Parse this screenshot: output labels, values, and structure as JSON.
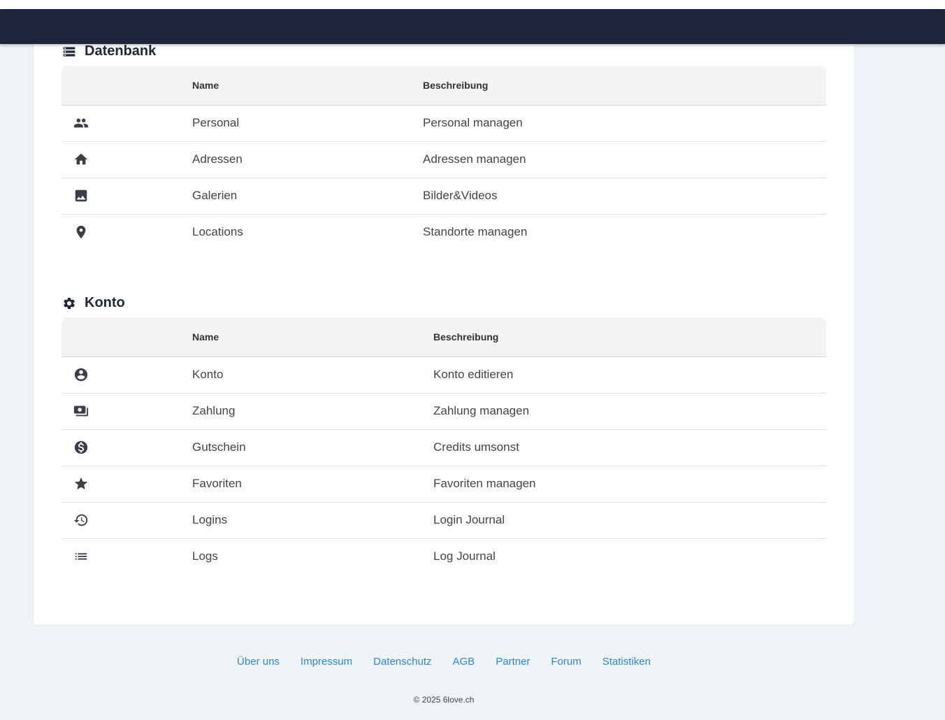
{
  "datenbank": {
    "title": "Datenbank",
    "icon": "database-list-icon",
    "headers": {
      "name": "Name",
      "description": "Beschreibung"
    },
    "rows": [
      {
        "icon": "people-icon",
        "name": "Personal",
        "description": "Personal managen"
      },
      {
        "icon": "home-icon",
        "name": "Adressen",
        "description": "Adressen managen"
      },
      {
        "icon": "image-icon",
        "name": "Galerien",
        "description": "Bilder&Videos"
      },
      {
        "icon": "location-pin-icon",
        "name": "Locations",
        "description": "Standorte managen"
      }
    ]
  },
  "konto": {
    "title": "Konto",
    "icon": "gear-icon",
    "headers": {
      "name": "Name",
      "description": "Beschreibung"
    },
    "rows": [
      {
        "icon": "account-circle-icon",
        "name": "Konto",
        "description": "Konto editieren"
      },
      {
        "icon": "payments-icon",
        "name": "Zahlung",
        "description": "Zahlung managen"
      },
      {
        "icon": "dollar-coin-icon",
        "name": "Gutschein",
        "description": "Credits umsonst"
      },
      {
        "icon": "star-icon",
        "name": "Favoriten",
        "description": "Favoriten managen"
      },
      {
        "icon": "history-icon",
        "name": "Logins",
        "description": "Login Journal"
      },
      {
        "icon": "list-icon",
        "name": "Logs",
        "description": "Log Journal"
      }
    ]
  },
  "footer": {
    "links": [
      "Über uns",
      "Impressum",
      "Datenschutz",
      "AGB",
      "Partner",
      "Forum",
      "Statistiken"
    ],
    "copyright": "© 2025 6love.ch"
  },
  "colors": {
    "topbar": "#1c253c",
    "background": "#eef4f8",
    "link": "#2f86d1"
  }
}
